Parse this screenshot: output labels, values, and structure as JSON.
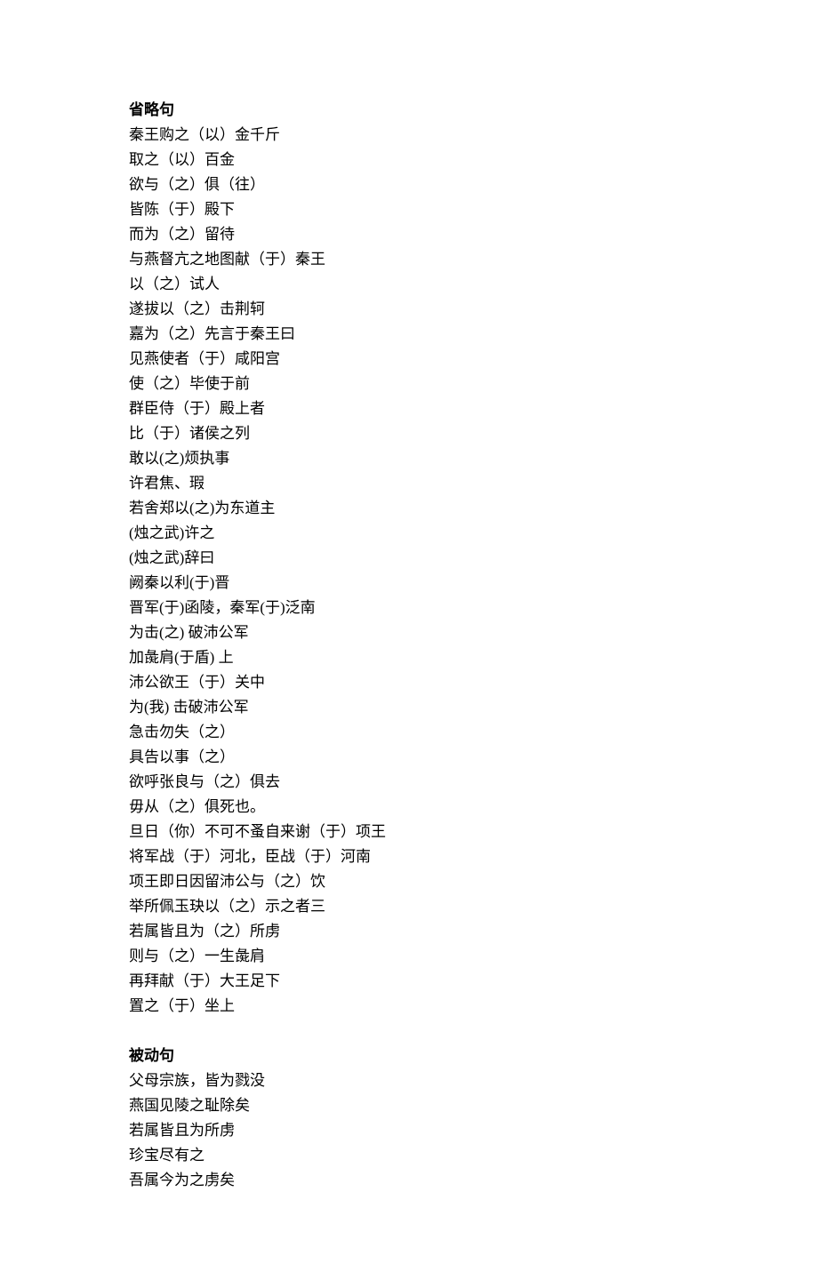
{
  "sections": [
    {
      "heading": "省略句",
      "lines": [
        "秦王购之（以）金千斤",
        "取之（以）百金",
        "欲与（之）俱（往）",
        "皆陈（于）殿下",
        "而为（之）留待",
        "与燕督亢之地图献（于）秦王",
        "以（之）试人",
        "遂拔以（之）击荆轲",
        "嘉为（之）先言于秦王曰",
        "见燕使者（于）咸阳宫",
        "使（之）毕使于前",
        "群臣侍（于）殿上者",
        "比（于）诸侯之列",
        "敢以(之)烦执事",
        "许君焦、瑕",
        "若舍郑以(之)为东道主",
        "(烛之武)许之",
        "(烛之武)辞曰",
        "阙秦以利(于)晋",
        "晋军(于)函陵，秦军(于)泛南",
        "为击(之) 破沛公军",
        "加彘肩(于盾) 上",
        "沛公欲王（于）关中",
        "为(我) 击破沛公军",
        "急击勿失（之）",
        "具告以事（之）",
        "欲呼张良与（之）俱去",
        "毋从（之）俱死也。",
        "旦日（你）不可不蚤自来谢（于）项王",
        "将军战（于）河北，臣战（于）河南",
        "项王即日因留沛公与（之）饮",
        "举所佩玉玦以（之）示之者三",
        "若属皆且为（之）所虏",
        "则与（之）一生彘肩",
        "再拜献（于）大王足下",
        "置之（于）坐上"
      ]
    },
    {
      "heading": "被动句",
      "lines": [
        "父母宗族，皆为戮没",
        "燕国见陵之耻除矣",
        "若属皆且为所虏",
        "珍宝尽有之",
        "吾属今为之虏矣"
      ]
    }
  ]
}
